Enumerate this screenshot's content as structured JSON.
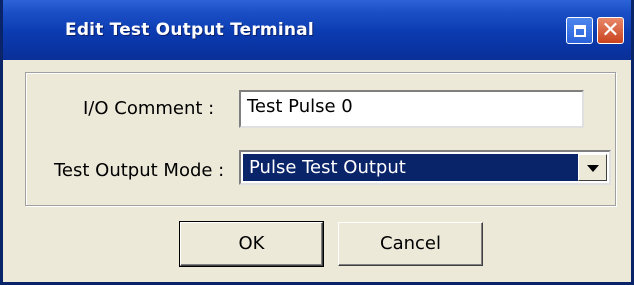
{
  "window": {
    "title": "Edit Test Output Terminal"
  },
  "titlebar_buttons": {
    "restore_icon": "restore-icon",
    "close_glyph": "✕"
  },
  "form": {
    "io_comment_label": "I/O Comment :",
    "io_comment_value": "Test Pulse 0",
    "test_output_mode_label": "Test Output Mode :",
    "test_output_mode_value": "Pulse Test Output"
  },
  "buttons": {
    "ok_label": "OK",
    "cancel_label": "Cancel"
  },
  "colors": {
    "titlebar": "#0b3bb0",
    "selection": "#0a246a",
    "dialog_bg": "#ece9d8"
  }
}
